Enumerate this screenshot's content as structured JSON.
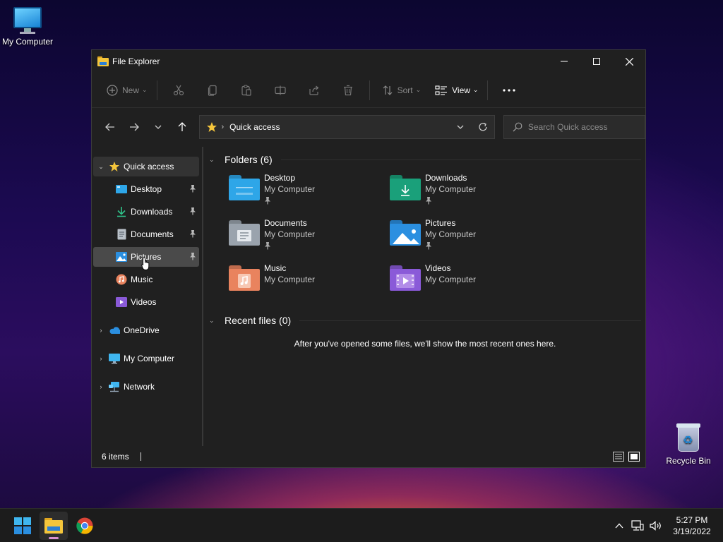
{
  "desktop": {
    "icons": [
      {
        "label": "My Computer"
      },
      {
        "label": "Recycle Bin"
      }
    ]
  },
  "window": {
    "title": "File Explorer",
    "accent": "#f4c53b"
  },
  "toolbar": {
    "new_label": "New",
    "sort_label": "Sort",
    "view_label": "View",
    "icons": [
      "plus-circle-icon",
      "cut-icon",
      "copy-icon",
      "paste-icon",
      "rename-icon",
      "share-icon",
      "delete-icon",
      "sort-icon",
      "view-icon",
      "more-icon"
    ]
  },
  "address": {
    "location": "Quick access"
  },
  "search": {
    "placeholder": "Search Quick access"
  },
  "sidebar": {
    "quick_access": "Quick access",
    "pinned": [
      {
        "label": "Desktop"
      },
      {
        "label": "Downloads"
      },
      {
        "label": "Documents"
      },
      {
        "label": "Pictures"
      },
      {
        "label": "Music"
      },
      {
        "label": "Videos"
      }
    ],
    "roots": [
      {
        "label": "OneDrive"
      },
      {
        "label": "My Computer"
      },
      {
        "label": "Network"
      }
    ]
  },
  "folders": {
    "heading": "Folders (6)",
    "items": [
      {
        "name": "Desktop",
        "location": "My Computer",
        "color": "#2ea6e8"
      },
      {
        "name": "Downloads",
        "location": "My Computer",
        "color": "#1aa07a"
      },
      {
        "name": "Documents",
        "location": "My Computer",
        "color": "#9aa3ad"
      },
      {
        "name": "Pictures",
        "location": "My Computer",
        "color": "#2b8fe0"
      },
      {
        "name": "Music",
        "location": "My Computer",
        "color": "#e9835e"
      },
      {
        "name": "Videos",
        "location": "My Computer",
        "color": "#8a5ad8"
      }
    ]
  },
  "recent": {
    "heading": "Recent files (0)",
    "message": "After you've opened some files, we'll show the most recent ones here."
  },
  "status": {
    "items": "6 items"
  },
  "taskbar": {
    "time": "5:27 PM",
    "date": "3/19/2022"
  }
}
